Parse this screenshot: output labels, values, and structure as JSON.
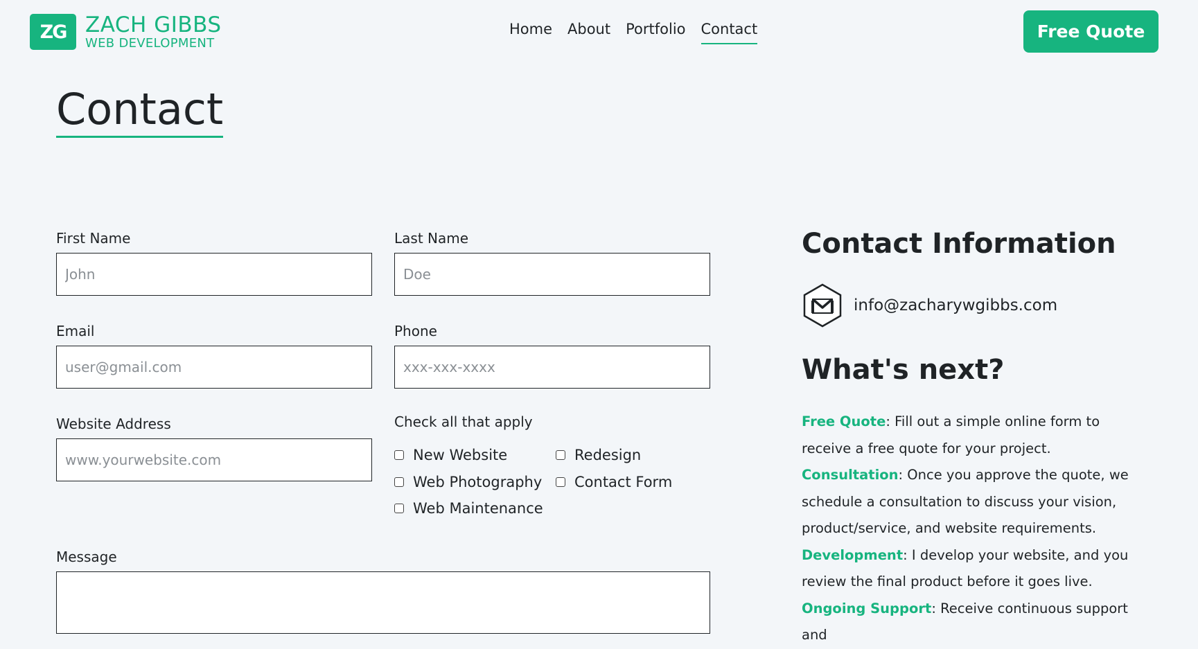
{
  "header": {
    "logo_mark": "ZG",
    "logo_name": "ZACH GIBBS",
    "logo_sub": "WEB DEVELOPMENT",
    "nav": [
      "Home",
      "About",
      "Portfolio",
      "Contact"
    ],
    "active_nav": "Contact",
    "cta_label": "Free Quote"
  },
  "colors": {
    "accent": "#17b47f",
    "background": "#f3f6f9",
    "text": "#1f2326"
  },
  "page": {
    "title": "Contact"
  },
  "form": {
    "first_name": {
      "label": "First Name",
      "placeholder": "John",
      "value": ""
    },
    "last_name": {
      "label": "Last Name",
      "placeholder": "Doe",
      "value": ""
    },
    "email": {
      "label": "Email",
      "placeholder": "user@gmail.com",
      "value": ""
    },
    "phone": {
      "label": "Phone",
      "placeholder": "xxx-xxx-xxxx",
      "value": ""
    },
    "website": {
      "label": "Website Address",
      "placeholder": "www.yourwebsite.com",
      "value": ""
    },
    "checks_title": "Check all that apply",
    "checks": [
      {
        "label": "New Website",
        "checked": false
      },
      {
        "label": "Redesign",
        "checked": false
      },
      {
        "label": "Web Photography",
        "checked": false
      },
      {
        "label": "Contact Form",
        "checked": false
      },
      {
        "label": "Web Maintenance",
        "checked": false
      }
    ],
    "message": {
      "label": "Message",
      "value": ""
    }
  },
  "contact_info": {
    "title": "Contact Information",
    "email": "info@zacharywgibbs.com",
    "icon": "gmail-hexagon-icon"
  },
  "whats_next": {
    "title": "What's next?",
    "steps": [
      {
        "name": "Free Quote",
        "text": ": Fill out a simple online form to receive a free quote for your project."
      },
      {
        "name": "Consultation",
        "text": ": Once you approve the quote, we schedule a consultation to discuss your vision, product/service, and website requirements."
      },
      {
        "name": "Development",
        "text": ": I develop your website, and you review the final product before it goes live."
      },
      {
        "name": "Ongoing Support",
        "text": ": Receive continuous support and"
      }
    ]
  }
}
